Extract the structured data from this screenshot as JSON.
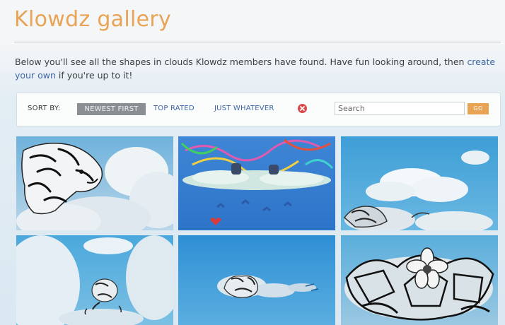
{
  "header": {
    "title": "Klowdz gallery"
  },
  "intro": {
    "text_before": "Below you'll see all the shapes in clouds Klowdz members have found. Have fun looking around, then ",
    "link_text": "create your own",
    "text_after": " if you're up to it!"
  },
  "toolbar": {
    "sort_label": "SORT BY:",
    "sort_options": [
      "NEWEST FIRST",
      "TOP RATED",
      "JUST WHATEVER"
    ],
    "active_sort": "NEWEST FIRST",
    "clear_icon": "close-circle-icon",
    "search_placeholder": "Search",
    "go_label": "GO"
  },
  "gallery": {
    "thumbnails": [
      {
        "subject": "tiger-cloud-drawing"
      },
      {
        "subject": "colorful-painted-cloud-scene"
      },
      {
        "subject": "sky-with-clouds-and-creature-drawing"
      },
      {
        "subject": "small-creature-in-clouds"
      },
      {
        "subject": "cloud-creature-drawing"
      },
      {
        "subject": "flower-web-cloud-drawing"
      }
    ]
  },
  "colors": {
    "title": "#e8a355",
    "link": "#3d66a6",
    "active_sort_bg": "#8a8f93",
    "go_button": "#e8a355",
    "clear_icon": "#d94a4a"
  }
}
